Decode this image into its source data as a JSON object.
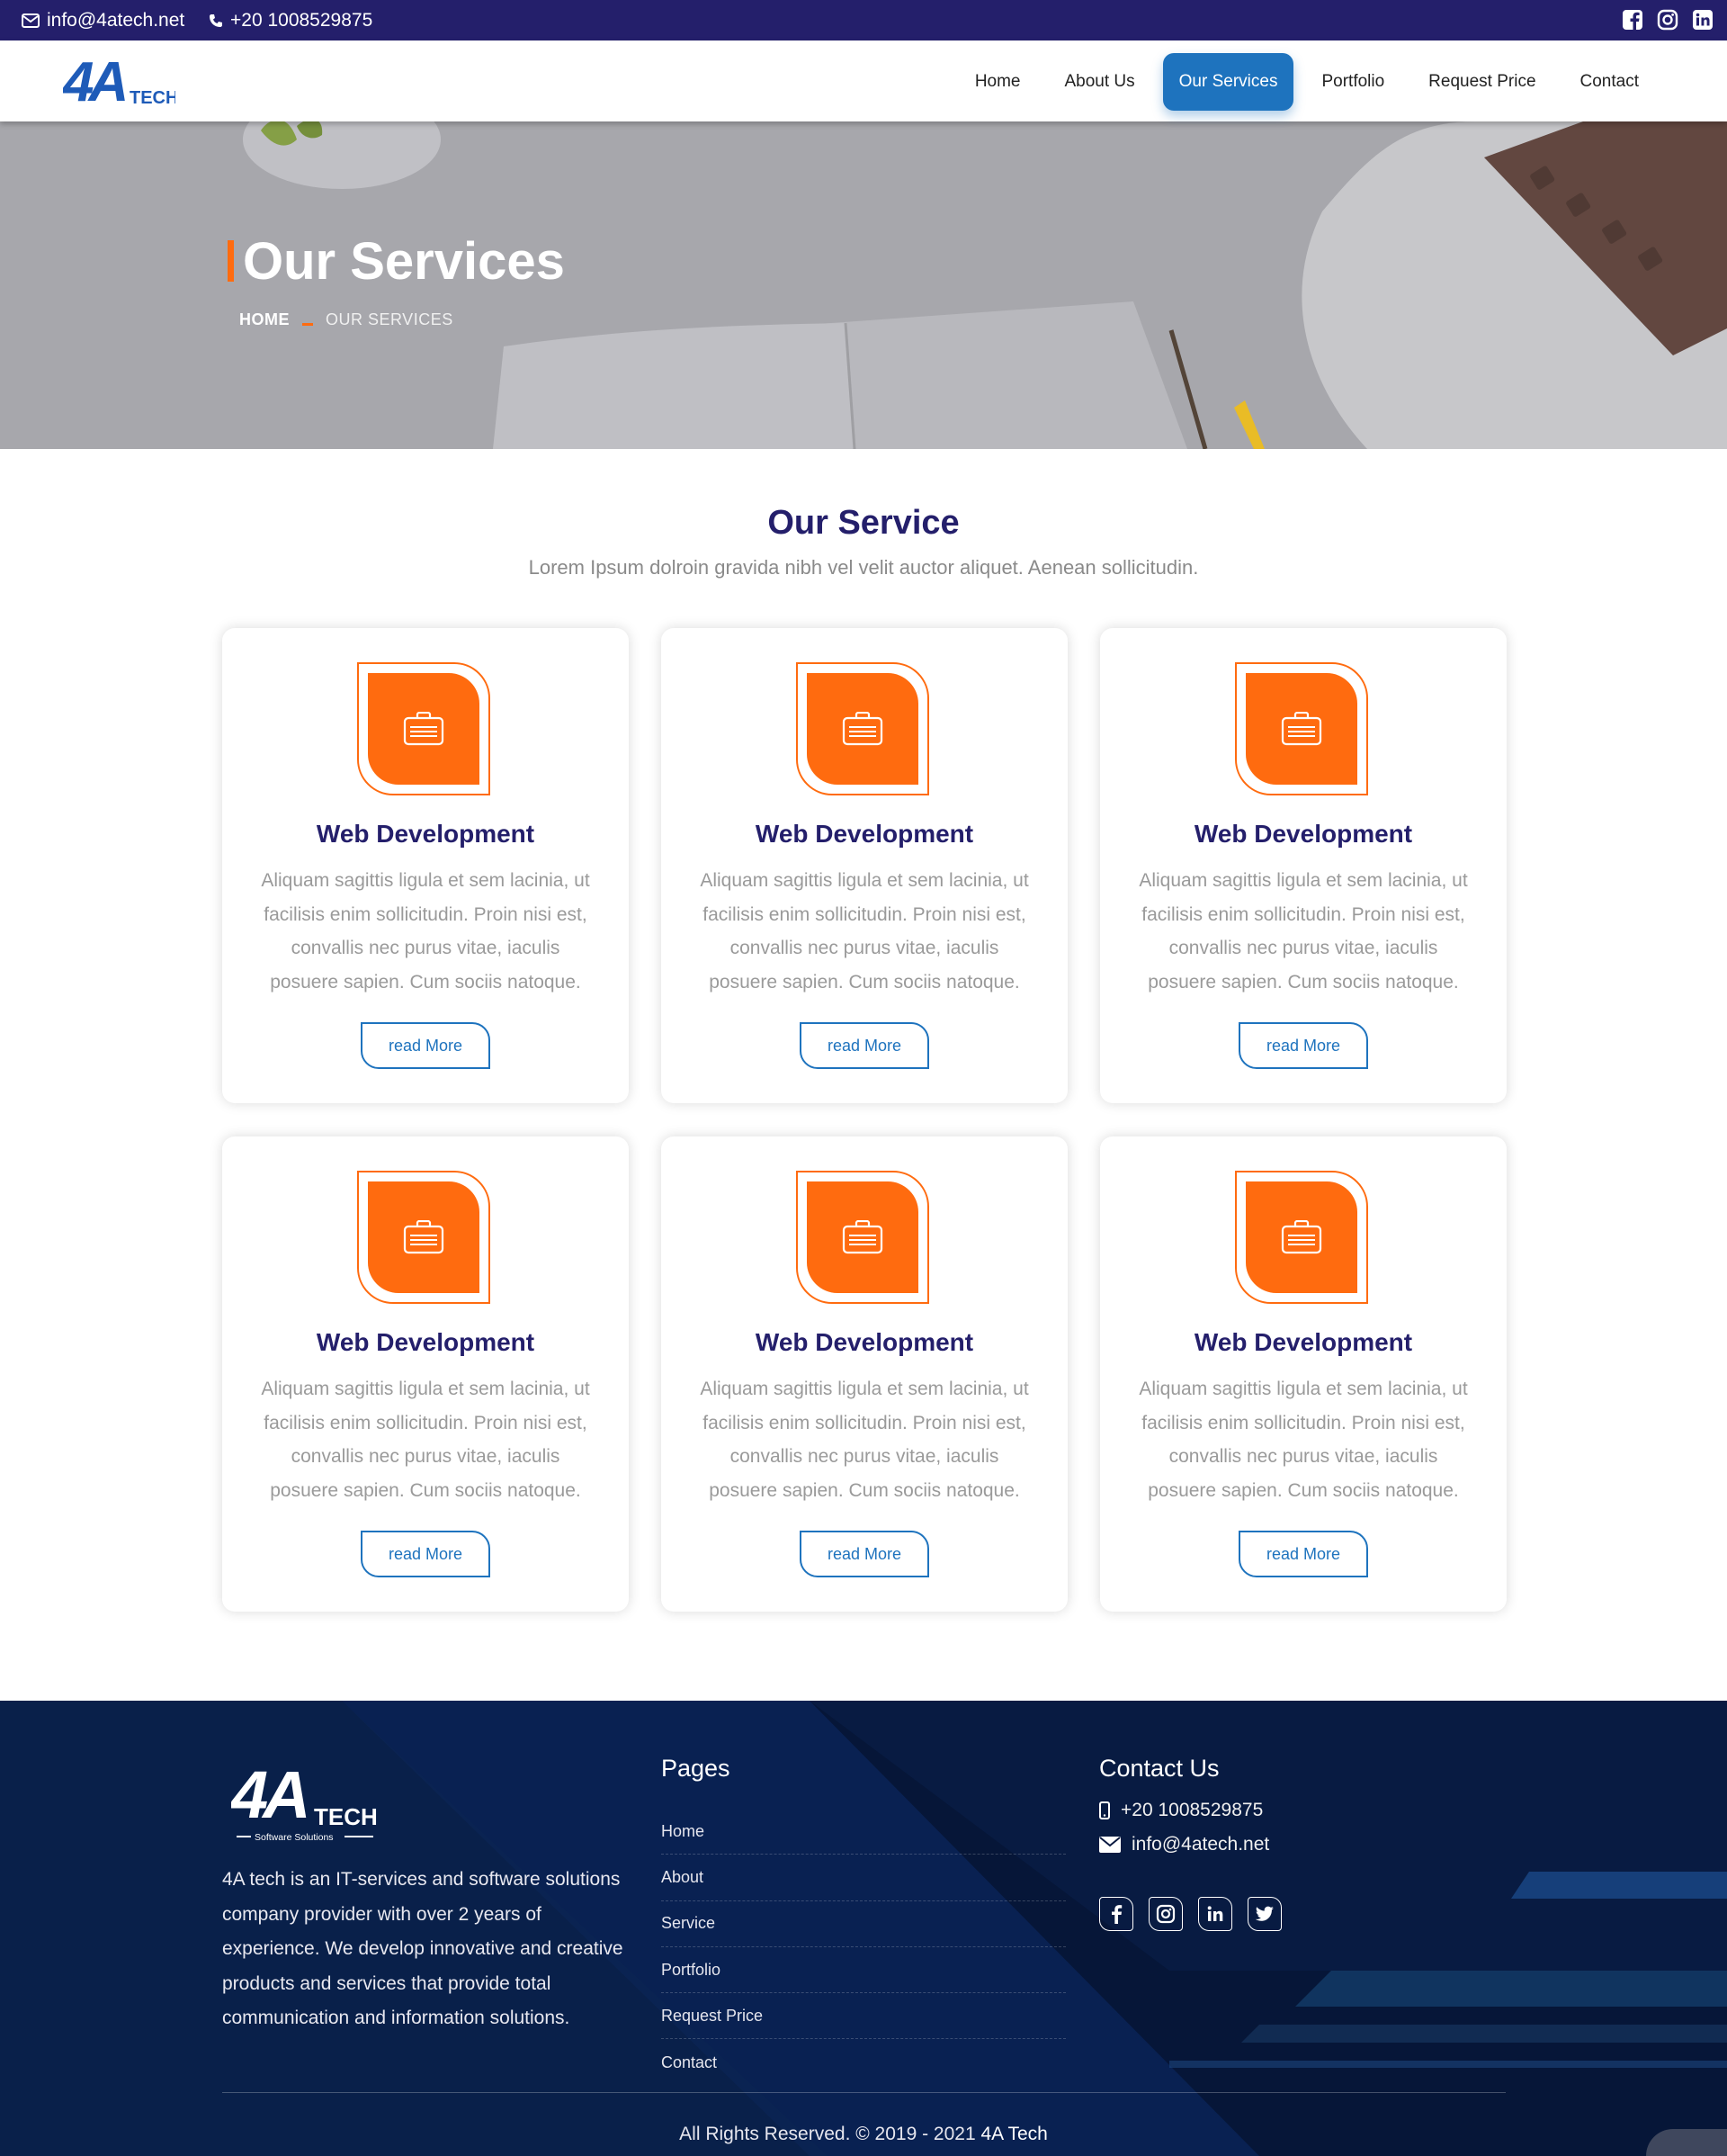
{
  "topbar": {
    "email": "info@4atech.net",
    "phone": "+20 1008529875",
    "social_icons": [
      "facebook-icon",
      "instagram-icon",
      "linkedin-icon"
    ]
  },
  "header": {
    "logo_text": "4A",
    "logo_sub": "TECH",
    "nav": [
      {
        "label": "Home",
        "active": false
      },
      {
        "label": "About Us",
        "active": false
      },
      {
        "label": "Our Services",
        "active": true
      },
      {
        "label": "Portfolio",
        "active": false
      },
      {
        "label": "Request Price",
        "active": false
      },
      {
        "label": "Contact",
        "active": false
      }
    ]
  },
  "hero": {
    "title": "Our Services",
    "breadcrumb_home": "HOME",
    "breadcrumb_current": "OUR SERVICES"
  },
  "services": {
    "title": "Our Service",
    "subtitle": "Lorem Ipsum dolroin gravida nibh vel velit auctor aliquet. Aenean sollicitudin.",
    "cards": [
      {
        "title": "Web Development",
        "text": "Aliquam sagittis ligula et sem lacinia, ut facilisis enim sollicitudin. Proin nisi est, convallis nec purus vitae, iaculis posuere sapien. Cum sociis natoque.",
        "button": "read More",
        "icon": "briefcase-icon"
      },
      {
        "title": "Web Development",
        "text": "Aliquam sagittis ligula et sem lacinia, ut facilisis enim sollicitudin. Proin nisi est, convallis nec purus vitae, iaculis posuere sapien. Cum sociis natoque.",
        "button": "read More",
        "icon": "briefcase-icon"
      },
      {
        "title": "Web Development",
        "text": "Aliquam sagittis ligula et sem lacinia, ut facilisis enim sollicitudin. Proin nisi est, convallis nec purus vitae, iaculis posuere sapien. Cum sociis natoque.",
        "button": "read More",
        "icon": "briefcase-icon"
      },
      {
        "title": "Web Development",
        "text": "Aliquam sagittis ligula et sem lacinia, ut facilisis enim sollicitudin. Proin nisi est, convallis nec purus vitae, iaculis posuere sapien. Cum sociis natoque.",
        "button": "read More",
        "icon": "briefcase-icon"
      },
      {
        "title": "Web Development",
        "text": "Aliquam sagittis ligula et sem lacinia, ut facilisis enim sollicitudin. Proin nisi est, convallis nec purus vitae, iaculis posuere sapien. Cum sociis natoque.",
        "button": "read More",
        "icon": "briefcase-icon"
      },
      {
        "title": "Web Development",
        "text": "Aliquam sagittis ligula et sem lacinia, ut facilisis enim sollicitudin. Proin nisi est, convallis nec purus vitae, iaculis posuere sapien. Cum sociis natoque.",
        "button": "read More",
        "icon": "briefcase-icon"
      }
    ]
  },
  "footer": {
    "logo_text": "4A",
    "logo_sub": "TECH",
    "logo_tagline": "Software Solutions",
    "about": "4A tech is an IT-services and software solutions company provider with over 2 years of experience. We develop innovative and creative products and services that provide total communication and information solutions.",
    "pages_title": "Pages",
    "pages": [
      "Home",
      "About",
      "Service",
      "Portfolio",
      "Request Price",
      "Contact"
    ],
    "contact_title": "Contact Us",
    "phone": "+20 1008529875",
    "email": "info@4atech.net",
    "social_icons": [
      "facebook-icon",
      "instagram-icon",
      "linkedin-icon",
      "twitter-icon"
    ],
    "copyright_prefix": "All Rights Reserved. © 2019 - 2021",
    "copyright_brand": "4A Tech"
  },
  "colors": {
    "navy": "#241f6b",
    "accent_orange": "#ff6b0f",
    "accent_blue": "#1e73be",
    "footer_bg": "#07183f"
  }
}
